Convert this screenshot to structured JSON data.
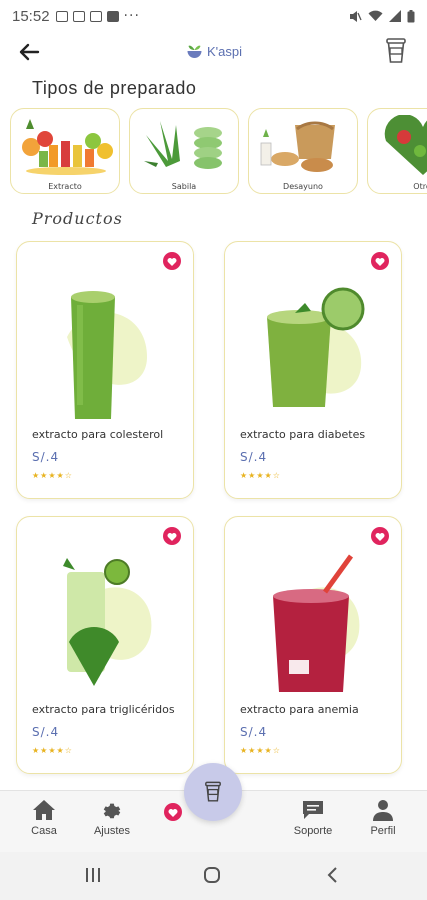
{
  "status_bar": {
    "time": "15:52",
    "dots": "···"
  },
  "app": {
    "title": "K'aspi"
  },
  "sections": {
    "categories_title": "Tipos de preparado",
    "products_title": "Productos"
  },
  "categories": [
    {
      "label": "Extracto"
    },
    {
      "label": "Sabila"
    },
    {
      "label": "Desayuno"
    },
    {
      "label": "Otro"
    }
  ],
  "products": [
    {
      "name": "extracto para colesterol",
      "price": "S/.4",
      "stars": "★★★★☆"
    },
    {
      "name": "extracto para diabetes",
      "price": "S/.4",
      "stars": "★★★★☆"
    },
    {
      "name": "extracto para triglicéridos",
      "price": "S/.4",
      "stars": "★★★★☆"
    },
    {
      "name": "extracto para anemia",
      "price": "S/.4",
      "stars": "★★★★☆"
    }
  ],
  "bottom_nav": {
    "home": "Casa",
    "settings": "Ajustes",
    "support": "Soporte",
    "profile": "Perfil"
  },
  "colors": {
    "accent": "#5b6fb0",
    "favorite": "#e0245e",
    "card_border": "#ece3a7",
    "fab": "#c8cae9"
  },
  "icons": [
    "back-arrow-icon",
    "cart-cup-icon",
    "heart-icon",
    "home-icon",
    "gear-icon",
    "chat-icon",
    "person-icon",
    "recent-apps-icon",
    "home-circle-icon",
    "back-chevron-icon"
  ]
}
